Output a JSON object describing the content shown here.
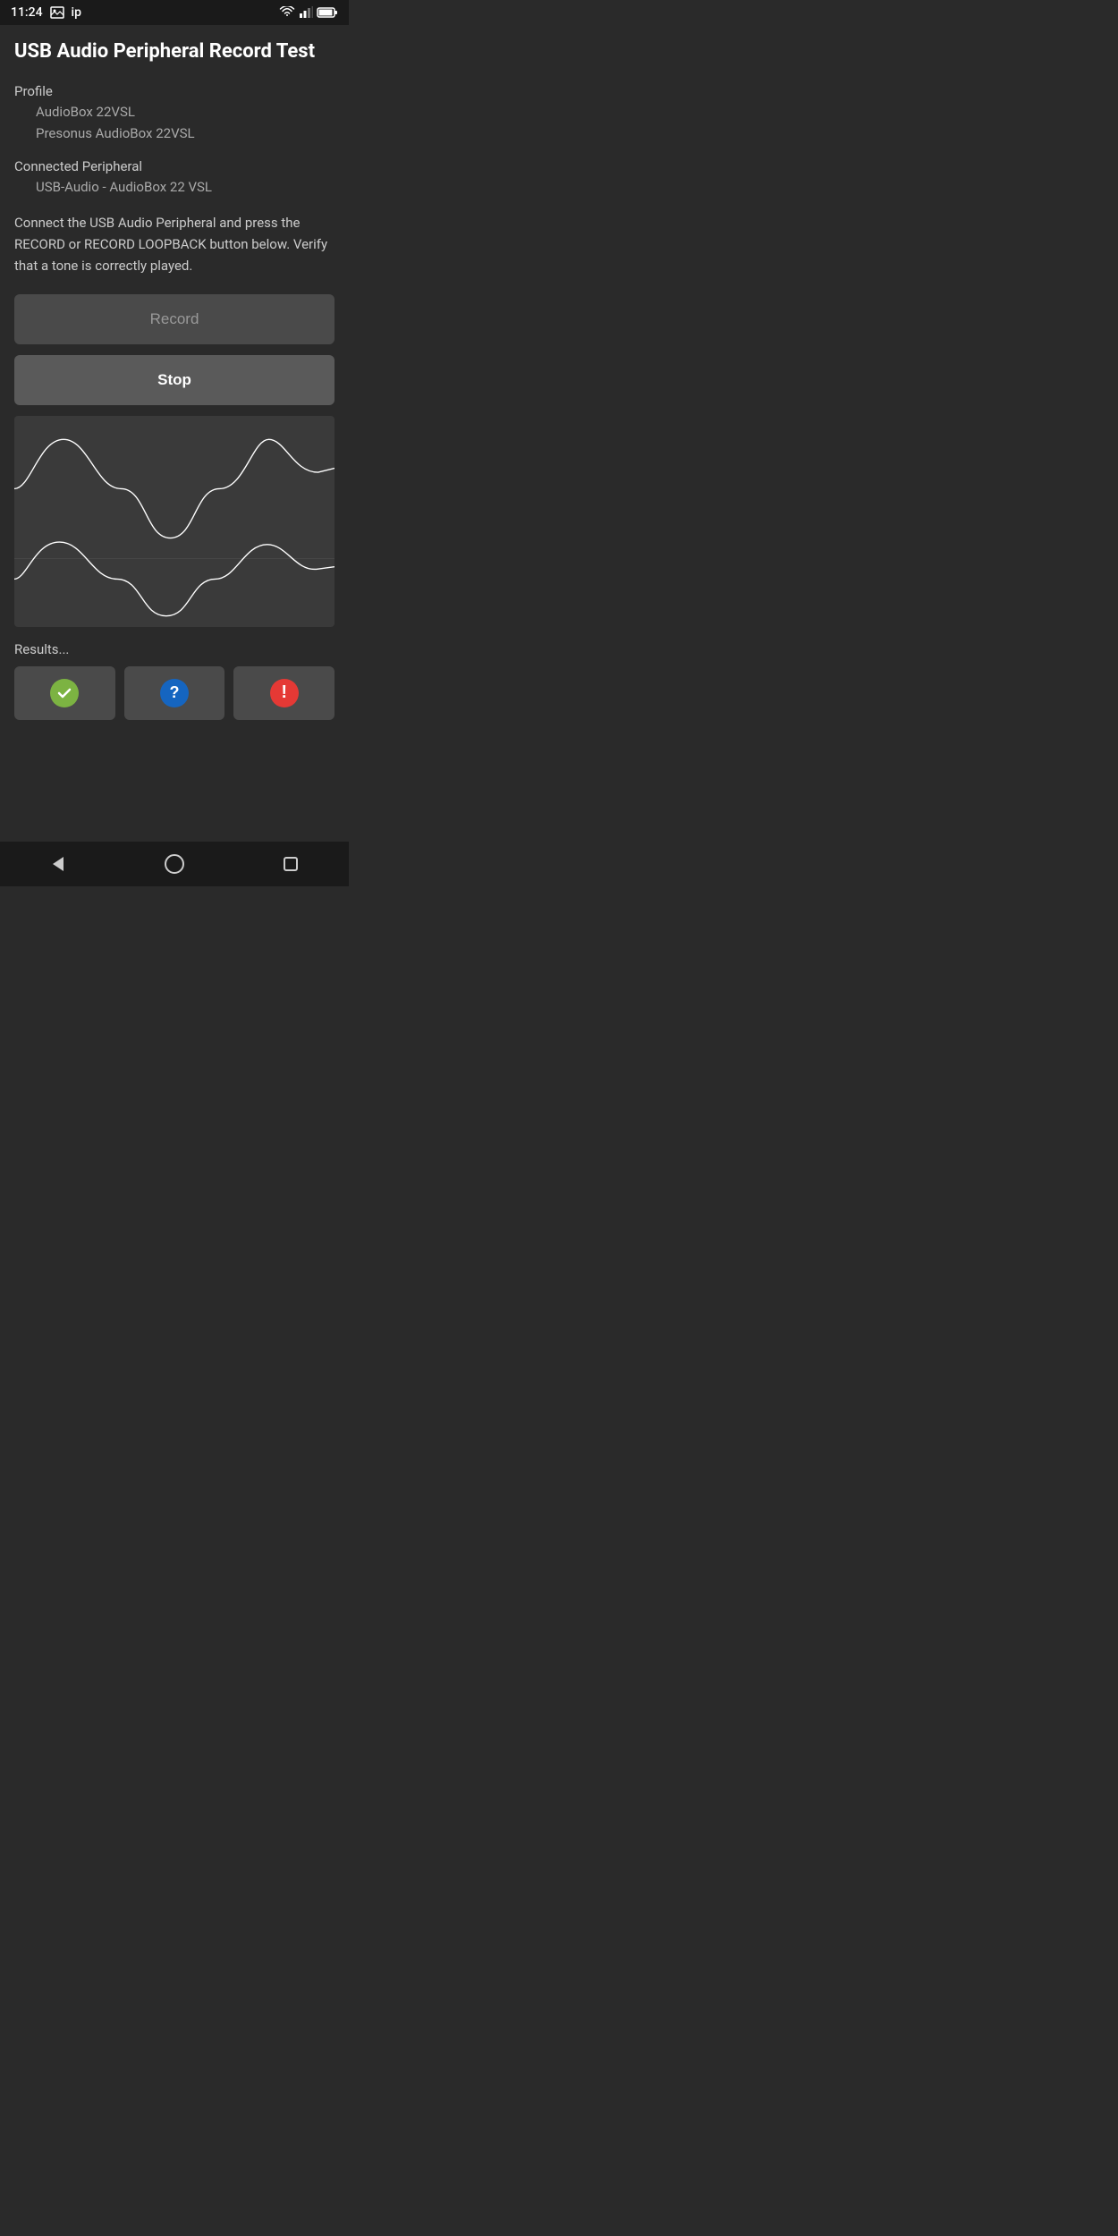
{
  "statusBar": {
    "time": "11:24",
    "notificationLabel": "ip"
  },
  "header": {
    "title": "USB Audio Peripheral Record Test"
  },
  "profileSection": {
    "label": "Profile",
    "profileName": "AudioBox 22VSL",
    "profileFull": "Presonus AudioBox 22VSL"
  },
  "peripheralSection": {
    "label": "Connected Peripheral",
    "deviceName": "USB-Audio - AudioBox 22 VSL"
  },
  "description": "Connect the USB Audio Peripheral and press the RECORD or RECORD LOOPBACK button below. Verify that a tone is correctly played.",
  "buttons": {
    "record": "Record",
    "stop": "Stop"
  },
  "results": {
    "label": "Results...",
    "successIcon": "✓",
    "helpIcon": "?",
    "errorIcon": "!"
  },
  "navBar": {
    "backLabel": "back",
    "homeLabel": "home",
    "recentLabel": "recent"
  }
}
